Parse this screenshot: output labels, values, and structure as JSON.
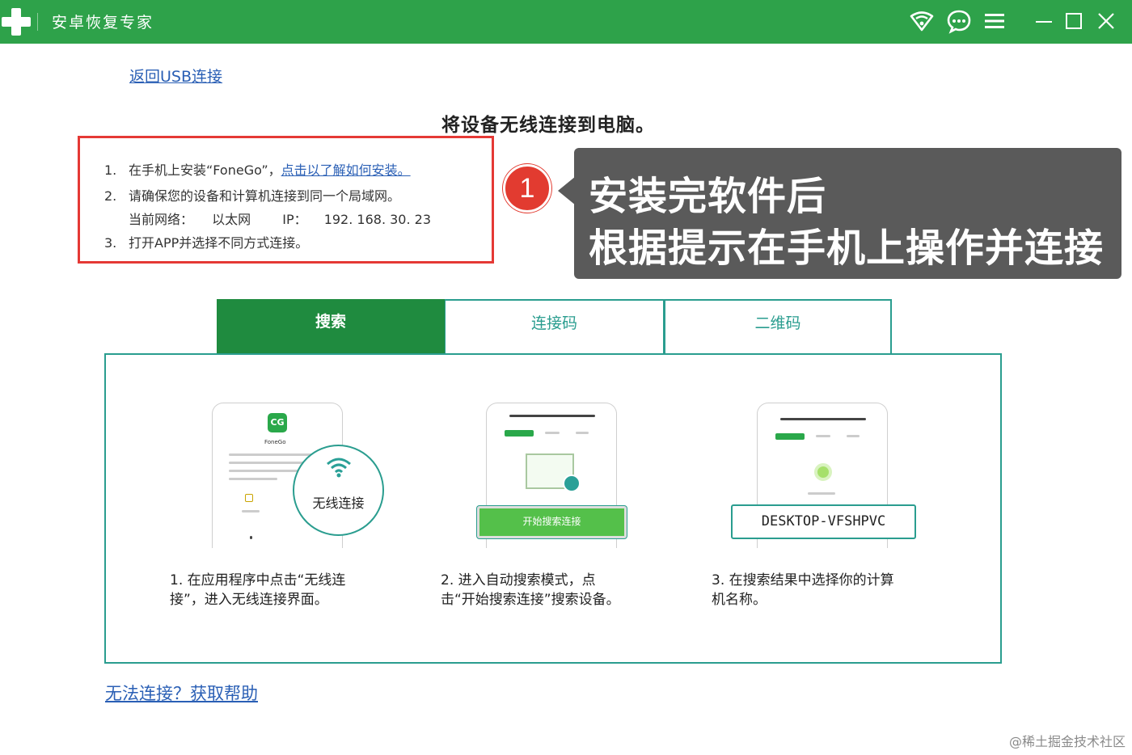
{
  "titlebar": {
    "title": "安卓恢复专家",
    "icons": [
      "cross-logo-icon",
      "wifi-shield-icon",
      "chat-icon",
      "menu-icon",
      "minimize-icon",
      "maximize-icon",
      "close-icon"
    ]
  },
  "back_link": "返回USB连接",
  "heading": "将设备无线连接到电脑。",
  "steps": {
    "step1_num": "1.",
    "step1_text": "在手机上安装“FoneGo”，",
    "step1_link": "点击以了解如何安装。",
    "step2_num": "2.",
    "step2_text": "请确保您的设备和计算机连接到同一个局域网。",
    "network_label": "当前网络：",
    "network_value": "以太网",
    "ip_label": "IP：",
    "ip_value": "192. 168. 30. 23",
    "step3_num": "3.",
    "step3_text": "打开APP并选择不同方式连接。"
  },
  "callout": {
    "badge": "1",
    "line1": "安装完软件后",
    "line2": "根据提示在手机上操作并连接"
  },
  "tabs": [
    {
      "label": "搜索",
      "active": true
    },
    {
      "label": "连接码",
      "active": false
    },
    {
      "label": "二维码",
      "active": false
    }
  ],
  "phone1": {
    "app_logo": "CG",
    "app_name": "FoneGo",
    "wifi_label": "无线连接"
  },
  "phone2": {
    "button": "开始搜索连接"
  },
  "phone3": {
    "pc_name": "DESKTOP-VFSHPVC"
  },
  "descriptions": [
    {
      "line1": "1.  在应用程序中点击“无线连",
      "line2": "接”，进入无线连接界面。"
    },
    {
      "line1": "2.  进入自动搜索模式，点",
      "line2": "击“开始搜索连接”搜索设备。"
    },
    {
      "line1": "3.  在搜索结果中选择你的计算",
      "line2": "机名称。"
    }
  ],
  "help_link": "无法连接？获取帮助",
  "watermark": "@稀土掘金技术社区",
  "colors": {
    "titlebar": "#2ea24a",
    "active_tab": "#1f8b3f",
    "teal_border": "#2a9d8f",
    "red_box": "#e53935",
    "callout_bg": "#5a5a5a",
    "link": "#2a5fb5"
  }
}
